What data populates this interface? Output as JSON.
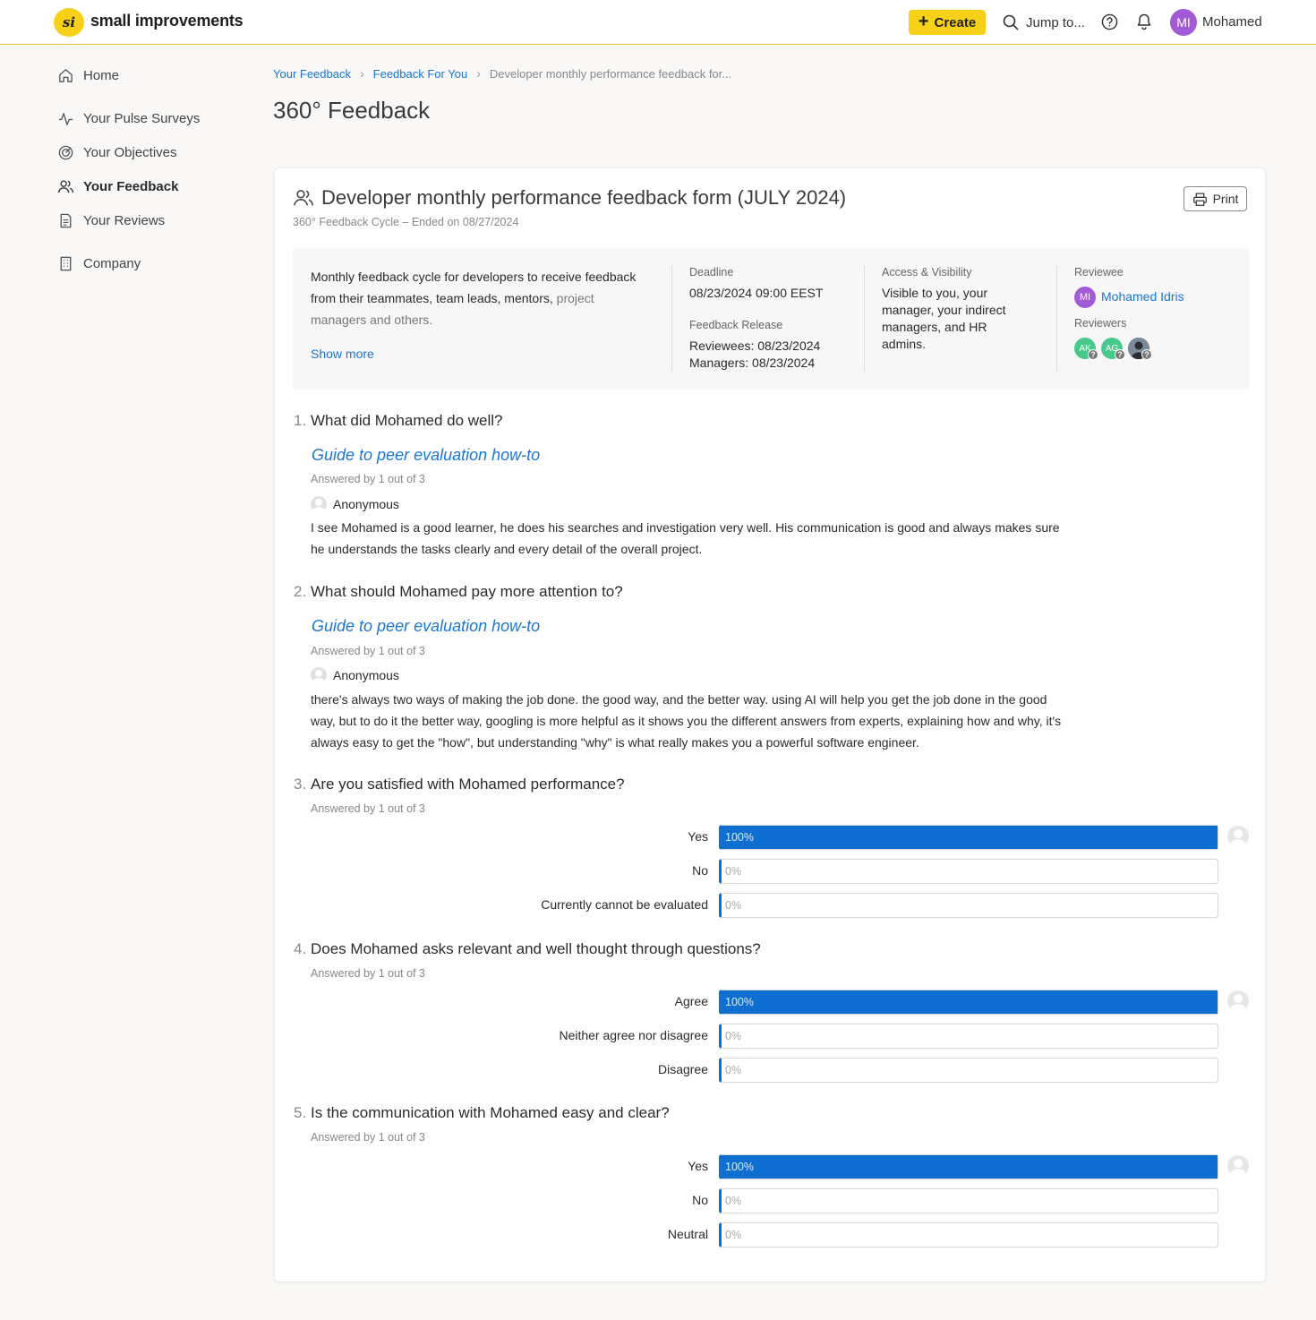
{
  "app": {
    "logo_mark": "si",
    "name": "small improvements"
  },
  "topbar": {
    "create_label": "Create",
    "jump_label": "Jump to...",
    "user_initials": "MI",
    "user_name": "Mohamed"
  },
  "sidebar": {
    "items": [
      {
        "label": "Home",
        "icon": "home-icon"
      },
      {
        "label": "Your Pulse Surveys",
        "icon": "pulse-icon"
      },
      {
        "label": "Your Objectives",
        "icon": "target-icon"
      },
      {
        "label": "Your Feedback",
        "icon": "people-icon",
        "active": true
      },
      {
        "label": "Your Reviews",
        "icon": "document-icon"
      },
      {
        "label": "Company",
        "icon": "building-icon"
      }
    ]
  },
  "breadcrumb": [
    "Your Feedback",
    "Feedback For You",
    "Developer monthly performance feedback for..."
  ],
  "page_title": "360° Feedback",
  "form": {
    "title": "Developer monthly performance feedback form (JULY 2024)",
    "subtitle": "360° Feedback Cycle – Ended on 08/27/2024",
    "print_label": "Print",
    "description_line1": "Monthly feedback cycle for developers to receive feedback from their teammates, team leads, mentors,",
    "description_line2": "project managers and others.",
    "show_more": "Show more",
    "deadline_label": "Deadline",
    "deadline_value": "08/23/2024 09:00 EEST",
    "release_label": "Feedback Release",
    "release_reviewees": "Reviewees: 08/23/2024",
    "release_managers": "Managers: 08/23/2024",
    "access_label": "Access & Visibility",
    "access_value": "Visible to you, your manager, your indirect managers, and HR admins.",
    "reviewee_label": "Reviewee",
    "reviewee_initials": "MI",
    "reviewee_name": "Mohamed Idris",
    "reviewers_label": "Reviewers",
    "reviewers": [
      "AK",
      "AG",
      "photo"
    ],
    "reviewer_badge": "?"
  },
  "questions": [
    {
      "num": "1.",
      "text": "What did Mohamed do well?",
      "guide": "Guide to peer evaluation how-to",
      "answered": "Answered by 1 out of 3",
      "author": "Anonymous",
      "answer": "I see Mohamed is a good learner, he does his searches and investigation very well. His communication is good and always makes sure he understands the tasks clearly and every detail of the overall project."
    },
    {
      "num": "2.",
      "text": "What should Mohamed pay more attention to?",
      "guide": "Guide to peer evaluation how-to",
      "answered": "Answered by 1 out of 3",
      "author": "Anonymous",
      "answer": "there's always two ways of making the job done. the good way, and the better way. using AI will help you get the job done in the good way, but to do it the better way, googling is more helpful as it shows you the different answers from experts, explaining how and why, it's always easy to get the \"how\", but understanding \"why\" is what really makes you a powerful software engineer."
    },
    {
      "num": "3.",
      "text": "Are you satisfied with Mohamed performance?",
      "answered": "Answered by 1 out of 3",
      "options": [
        {
          "label": "Yes",
          "percent": 100,
          "text": "100%"
        },
        {
          "label": "No",
          "percent": 0,
          "text": "0%"
        },
        {
          "label": "Currently cannot be evaluated",
          "percent": 0,
          "text": "0%"
        }
      ]
    },
    {
      "num": "4.",
      "text": "Does Mohamed asks relevant and well thought through questions?",
      "answered": "Answered by 1 out of 3",
      "options": [
        {
          "label": "Agree",
          "percent": 100,
          "text": "100%"
        },
        {
          "label": "Neither agree nor disagree",
          "percent": 0,
          "text": "0%"
        },
        {
          "label": "Disagree",
          "percent": 0,
          "text": "0%"
        }
      ]
    },
    {
      "num": "5.",
      "text": "Is the communication with Mohamed easy and clear?",
      "answered": "Answered by 1 out of 3",
      "options": [
        {
          "label": "Yes",
          "percent": 100,
          "text": "100%"
        },
        {
          "label": "No",
          "percent": 0,
          "text": "0%"
        },
        {
          "label": "Neutral",
          "percent": 0,
          "text": "0%"
        }
      ]
    }
  ],
  "colors": {
    "accent": "#0f6fd1",
    "brand": "#f7d117",
    "link": "#1b76d2",
    "avatar_purple": "#a25ad7",
    "reviewer_green": "#46c98a"
  }
}
